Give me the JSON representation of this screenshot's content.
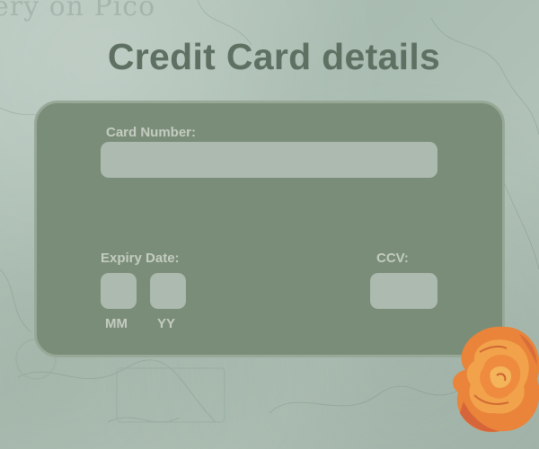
{
  "background": {
    "stamp_text": "ery on Pico"
  },
  "page": {
    "title": "Credit Card details"
  },
  "card": {
    "card_number_label": "Card Number:",
    "card_number_value": "",
    "expiry_label": "Expiry Date:",
    "month_caption": "MM",
    "year_caption": "YY",
    "ccv_label": "CCV:"
  },
  "decoration": {
    "icon": "rose-icon"
  },
  "colors": {
    "title": "#5e7062",
    "card_background": "#7a8d78",
    "card_border": "#97a897",
    "field": "#adbaaf",
    "label": "#c3ccc1",
    "page_background": "#b0c2b8",
    "rose": "#ee8a3c"
  }
}
